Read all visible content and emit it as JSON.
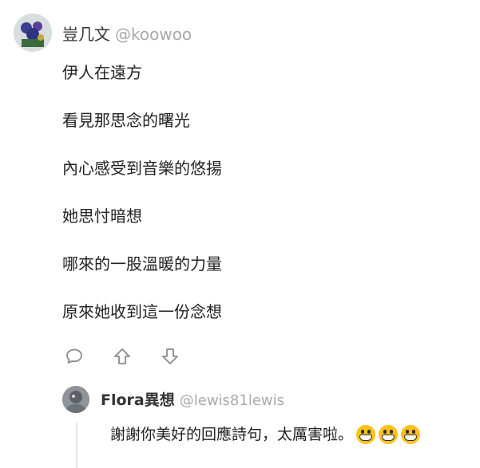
{
  "post": {
    "author_name": "豈几文",
    "author_handle": "@koowoo",
    "lines": [
      "伊人在遠方",
      "看見那思念的曙光",
      "內心感受到音樂的悠揚",
      "她思忖暗想",
      "哪來的一股溫暖的力量",
      "原來她收到這一份念想"
    ],
    "icons": [
      "comment-icon",
      "upvote-icon",
      "downvote-icon"
    ]
  },
  "reply": {
    "author_name": "Flora異想",
    "author_handle": "@lewis81lewis",
    "text": "謝謝你美好的回應詩句，太厲害啦。",
    "emoji": "grinning-face-icon",
    "emoji_count": 3
  },
  "colors": {
    "text": "#222222",
    "handle": "#a9a9a9",
    "icon": "#8a8a8a",
    "thread_line": "#e6e6e6",
    "emoji": "#fcc21b"
  }
}
